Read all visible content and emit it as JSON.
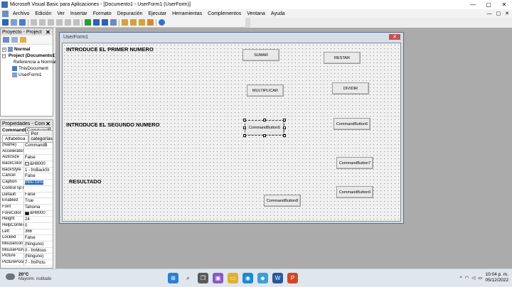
{
  "window": {
    "title": "Microsoft Visual Basic para Aplicaciones - [Documento1 - UserForm1 (UserForm)]",
    "controls": [
      "—",
      "▢",
      "✕"
    ]
  },
  "menu": {
    "items": [
      "Archivo",
      "Edición",
      "Ver",
      "Insertar",
      "Formato",
      "Depuración",
      "Ejecutar",
      "Herramientas",
      "Complementos",
      "Ventana",
      "Ayuda"
    ],
    "mdi_controls": [
      "—",
      "▢",
      "✕"
    ]
  },
  "project_pane": {
    "title": "Proyecto - Project",
    "nodes": [
      {
        "label": "Normal",
        "bold": true,
        "indent": 0
      },
      {
        "label": "Project (Documento1)",
        "bold": true,
        "indent": 0
      },
      {
        "label": "Referencia a Normal",
        "bold": false,
        "indent": 1
      },
      {
        "label": "ThisDocument",
        "bold": false,
        "indent": 1
      },
      {
        "label": "UserForm1",
        "bold": false,
        "indent": 1
      }
    ]
  },
  "properties_pane": {
    "title": "Propiedades - CommandButton5",
    "object_label": "CommandB",
    "object_value": "CommandButton5",
    "tabs": [
      "Alfabética",
      "Por categorías"
    ],
    "rows": [
      {
        "k": "(Name)",
        "v": "CommandB"
      },
      {
        "k": "Accelerator",
        "v": ""
      },
      {
        "k": "AutoSize",
        "v": "False"
      },
      {
        "k": "BackColor",
        "v": "&H8000",
        "swatch": "#f0f0f0"
      },
      {
        "k": "BackStyle",
        "v": "1 - fmBackSt"
      },
      {
        "k": "Cancel",
        "v": "False"
      },
      {
        "k": "Caption",
        "v": "mBu ton5",
        "selected": true
      },
      {
        "k": "ControlTipTe",
        "v": ""
      },
      {
        "k": "Default",
        "v": "False"
      },
      {
        "k": "Enabled",
        "v": "True"
      },
      {
        "k": "Font",
        "v": "Tahoma"
      },
      {
        "k": "ForeColor",
        "v": "&H8000",
        "swatch": "#000000"
      },
      {
        "k": "Height",
        "v": "24"
      },
      {
        "k": "HelpContextI",
        "v": "0"
      },
      {
        "k": "Left",
        "v": "366"
      },
      {
        "k": "Locked",
        "v": "False"
      },
      {
        "k": "MouseIcon",
        "v": "(Ninguno)"
      },
      {
        "k": "MousePointe",
        "v": "0 - fmMous"
      },
      {
        "k": "Picture",
        "v": "(Ninguno)"
      },
      {
        "k": "PicturePositi",
        "v": "7 - fmPictu"
      }
    ]
  },
  "userform": {
    "title": "UserForm1",
    "close": "✕",
    "labels": {
      "primer": "INTRODUCE EL PRIMER NUMERO",
      "segundo": "INTRODUCE EL SEGUNDO NUMERO",
      "resultado": "RESULTADO"
    },
    "buttons": {
      "sumar": "SUMAR",
      "restar": "RESTAR",
      "multiplicar": "MULTIPLICAR",
      "dividir": "DIVIDIR",
      "cb5": "CommandButton5",
      "cb6": "CommandButton6",
      "cb7": "CommandButton7",
      "cb8": "CommandButton8",
      "cb9": "CommandButton9"
    }
  },
  "taskbar": {
    "weather_temp": "20°C",
    "weather_desc": "Mayorm. nublado",
    "time": "10:04 p. m.",
    "date": "05/12/2022",
    "tray_lang": "^"
  }
}
